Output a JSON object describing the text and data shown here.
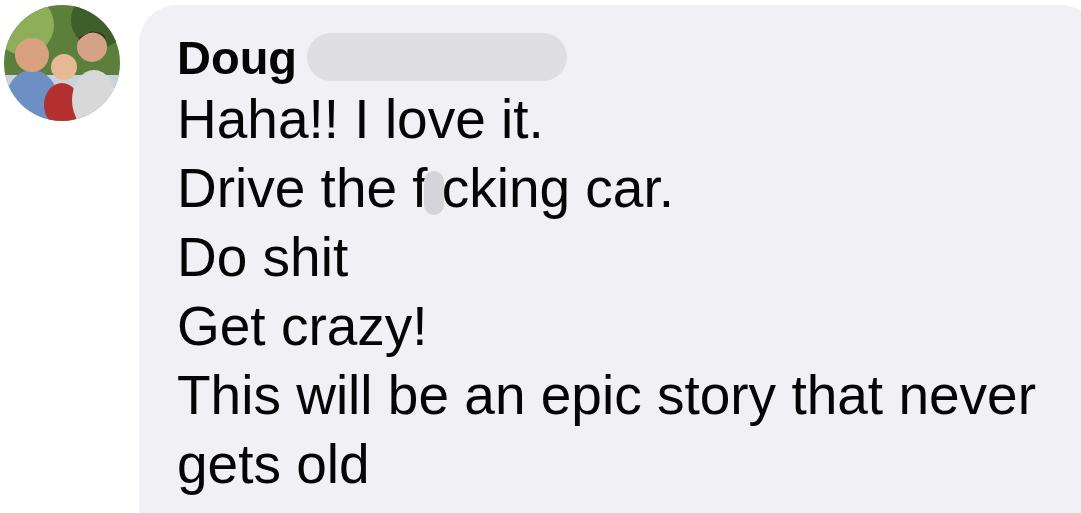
{
  "comment": {
    "author": "Doug",
    "author_redacted": true,
    "lines": [
      {
        "kind": "plain",
        "text": "Haha!! I love it."
      },
      {
        "kind": "redacted",
        "before": "Drive the f",
        "after": "cking car."
      },
      {
        "kind": "plain",
        "text": "Do shit"
      },
      {
        "kind": "plain",
        "text": "Get crazy!"
      },
      {
        "kind": "plain",
        "text": "This will be an epic story that never gets old"
      }
    ]
  }
}
